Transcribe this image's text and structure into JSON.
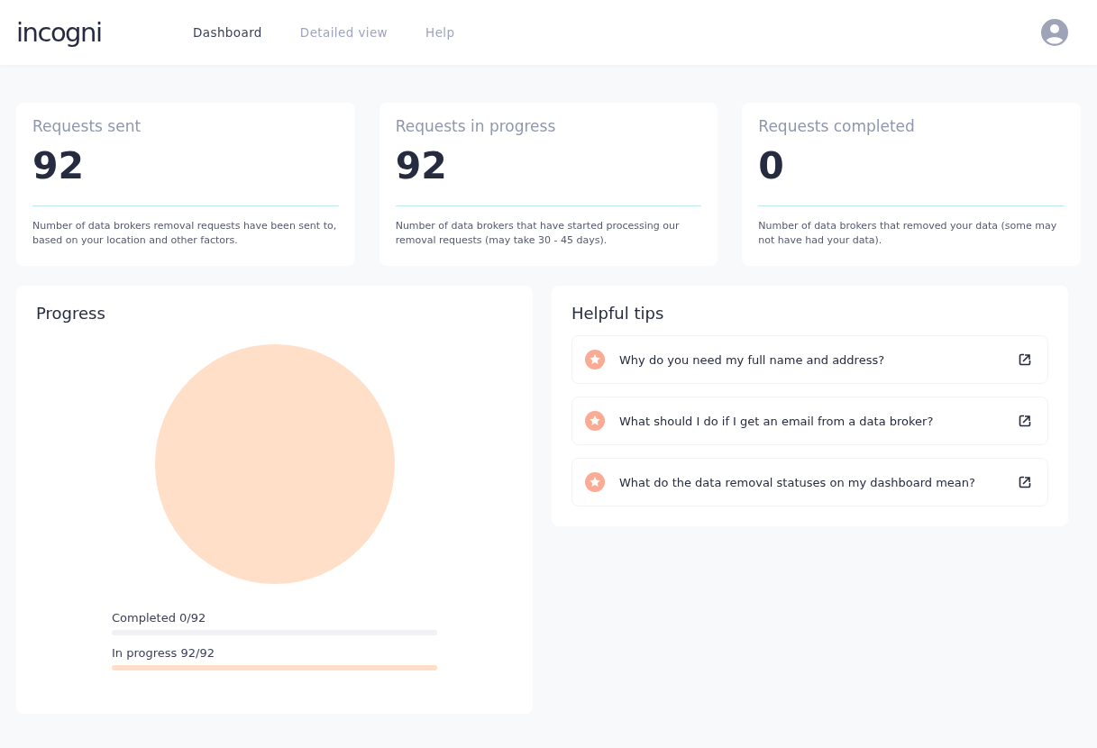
{
  "header": {
    "logo": "incogni",
    "nav": [
      {
        "label": "Dashboard",
        "selected": true
      },
      {
        "label": "Detailed view",
        "selected": false
      },
      {
        "label": "Help",
        "selected": false
      }
    ]
  },
  "stats": [
    {
      "title": "Requests sent",
      "value": "92",
      "description": "Number of data brokers removal requests have been sent to, based on your location and other factors."
    },
    {
      "title": "Requests in progress",
      "value": "92",
      "description": "Number of data brokers that have started processing our removal requests (may take 30 - 45 days)."
    },
    {
      "title": "Requests completed",
      "value": "0",
      "description": "Number of data brokers that removed your data (some may not have had your data)."
    }
  ],
  "progress": {
    "title": "Progress",
    "bars": [
      {
        "label": "Completed 0/92",
        "level": 0
      },
      {
        "label": "In progress 92/92",
        "level": 1
      }
    ]
  },
  "tips": {
    "title": "Helpful tips",
    "items": [
      "Why do you need my full name and address?",
      "What should I do if I get an email from a data broker?",
      "What do the data removal statuses on my dashboard mean?"
    ]
  }
}
